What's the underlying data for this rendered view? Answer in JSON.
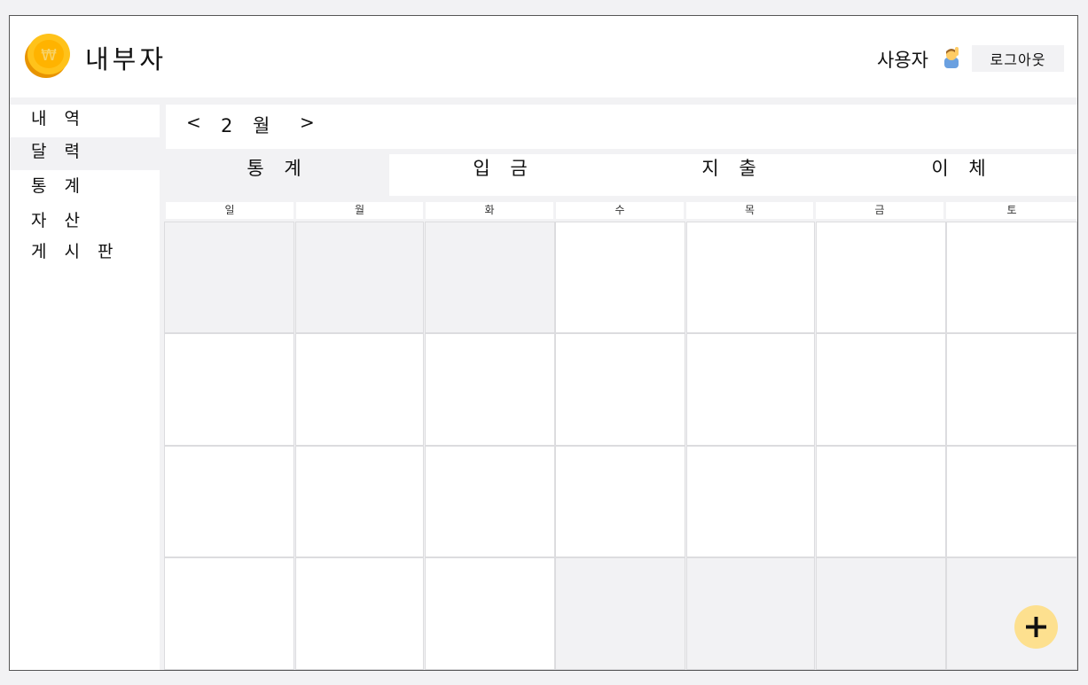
{
  "header": {
    "title": "내부자",
    "user_label": "사용자",
    "user_icon": "raising-hand-person-emoji",
    "logout_label": "로그아웃",
    "logo_icon": "won-coin-icon"
  },
  "sidebar": {
    "items": [
      {
        "label": "내 역",
        "active": false
      },
      {
        "label": "달 력",
        "active": true
      },
      {
        "label": "통 계",
        "active": false
      },
      {
        "label": "자 산",
        "active": false
      },
      {
        "label": "게 시 판",
        "active": false
      }
    ]
  },
  "month_nav": {
    "prev": "<",
    "next": ">",
    "month": "2 월"
  },
  "tabs": [
    {
      "label": "통 계",
      "active": true
    },
    {
      "label": "입 금",
      "active": false
    },
    {
      "label": "지 출",
      "active": false
    },
    {
      "label": "이 체",
      "active": false
    }
  ],
  "weekdays": [
    "일",
    "월",
    "화",
    "수",
    "목",
    "금",
    "토"
  ],
  "calendar": {
    "weeks": [
      [
        true,
        true,
        true,
        false,
        false,
        false,
        false
      ],
      [
        false,
        false,
        false,
        false,
        false,
        false,
        false
      ],
      [
        false,
        false,
        false,
        false,
        false,
        false,
        false
      ],
      [
        false,
        false,
        false,
        true,
        true,
        true,
        true
      ]
    ]
  },
  "colors": {
    "accent": "#fde08f",
    "coin": "#f7b500",
    "background": "#f2f2f4"
  },
  "fab": {
    "icon": "plus-icon"
  }
}
